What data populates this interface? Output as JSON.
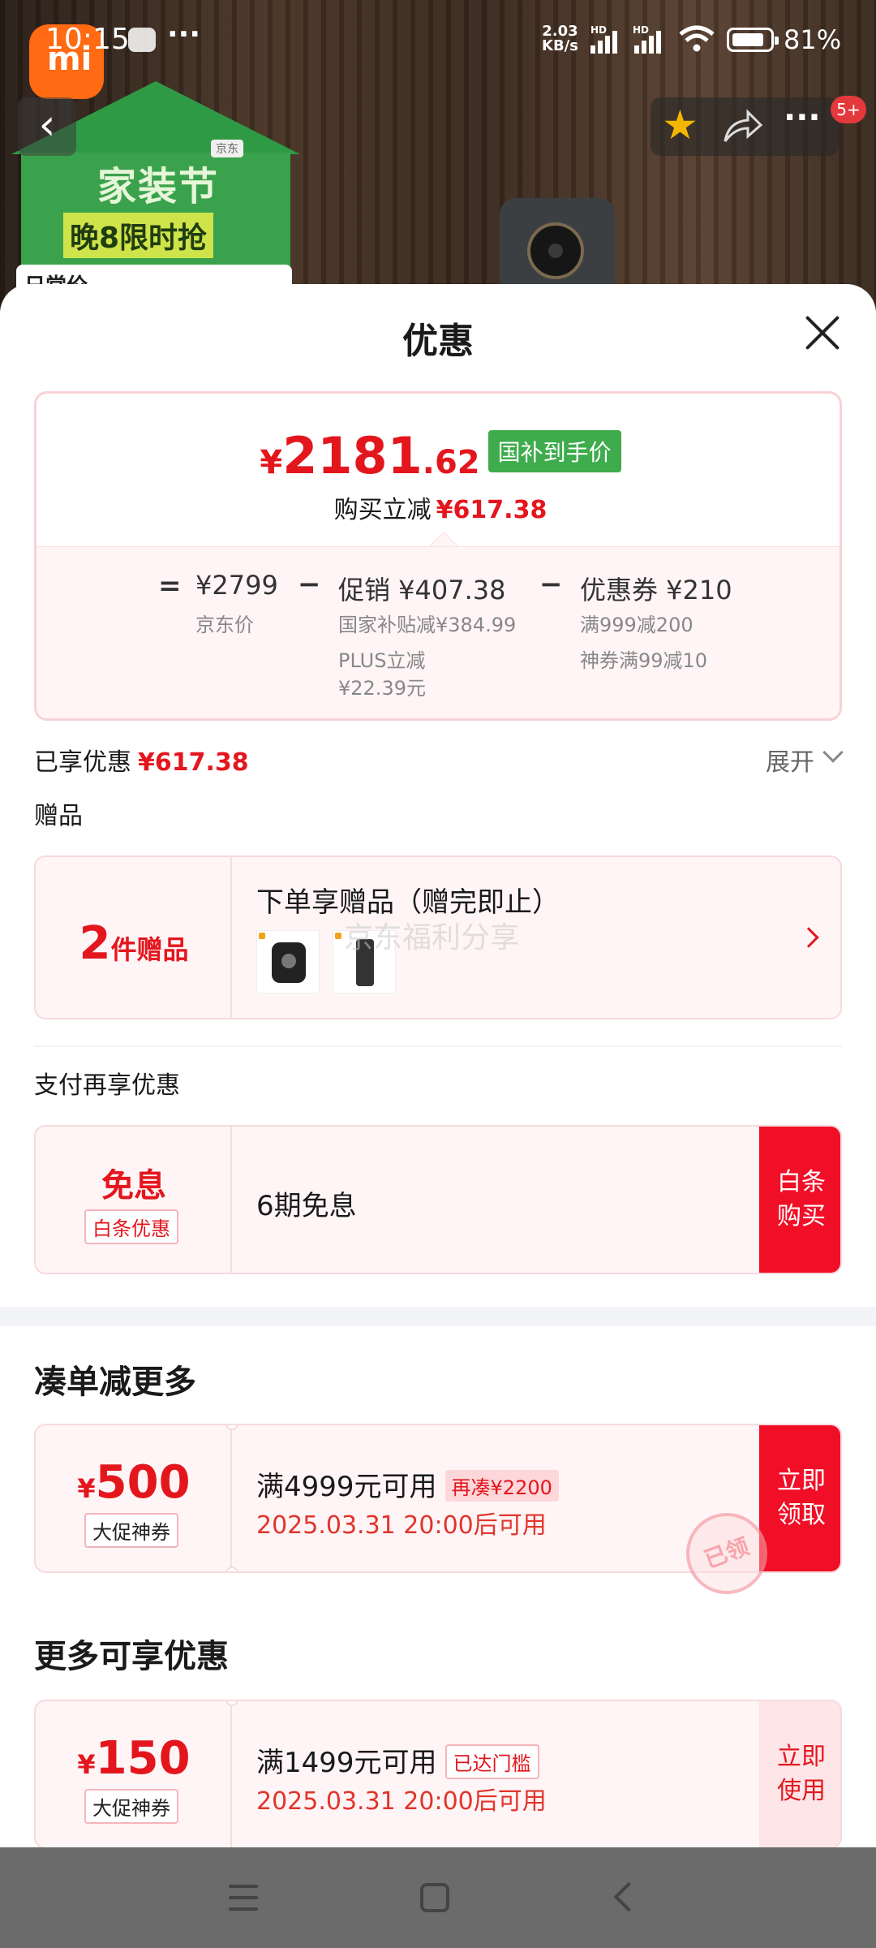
{
  "status_bar": {
    "time": "10:15",
    "more": "···",
    "net_speed_value": "2.03",
    "net_speed_unit": "KB/s",
    "hd_label": "HD",
    "battery_pct": "81%",
    "battery_level": 0.81
  },
  "background": {
    "promo_title": "家装节",
    "promo_sub": "晚8限时抢",
    "jd_mini": "京东",
    "daily_tab": "日常价",
    "logo_text": "mi",
    "badge": "5+"
  },
  "sheet": {
    "title": "优惠",
    "price_card": {
      "final_yen": "¥",
      "final_int": "2181",
      "final_dec": ".62",
      "subsidy_tag": "国补到手价",
      "save_label": "购买立减",
      "save_value": "¥617.38",
      "equals": "=",
      "minus": "−",
      "jd_price": "¥2799",
      "jd_price_label": "京东价",
      "promo_head": "促销 ¥407.38",
      "promo_sub1": "国家补贴减¥384.99",
      "promo_sub2a": "PLUS立减",
      "promo_sub2b": "¥22.39元",
      "coupon_head": "优惠券 ¥210",
      "coupon_sub1": "满999减200",
      "coupon_sub2": "神券满99减10"
    },
    "enjoyed_label": "已享优惠",
    "enjoyed_value": "¥617.38",
    "expand_label": "展开",
    "gift_section": "赠品",
    "gift_card": {
      "count": "2",
      "count_unit": "件赠品",
      "title": "下单享赠品（赠完即止）",
      "watermark": "京东福利分享"
    },
    "pay_section": "支付再享优惠",
    "pay_card": {
      "big": "免息",
      "tag": "白条优惠",
      "text": "6期免息",
      "button_line1": "白条",
      "button_line2": "购买"
    },
    "more_section": "凑单减更多",
    "coupon_500": {
      "yen": "¥",
      "amount": "500",
      "tag": "大促神券",
      "condition": "满4999元可用",
      "extra_tag": "再凑¥2200",
      "time": "2025.03.31 20:00后可用",
      "button_line1": "立即",
      "button_line2": "领取"
    },
    "enjoy_section": "更多可享优惠",
    "coupon_150": {
      "yen": "¥",
      "amount": "150",
      "tag": "大促神券",
      "condition": "满1499元可用",
      "extra_tag": "已达门槛",
      "time": "2025.03.31 20:00后可用",
      "button_line1": "立即",
      "button_line2": "使用",
      "stamp": "已领"
    }
  }
}
